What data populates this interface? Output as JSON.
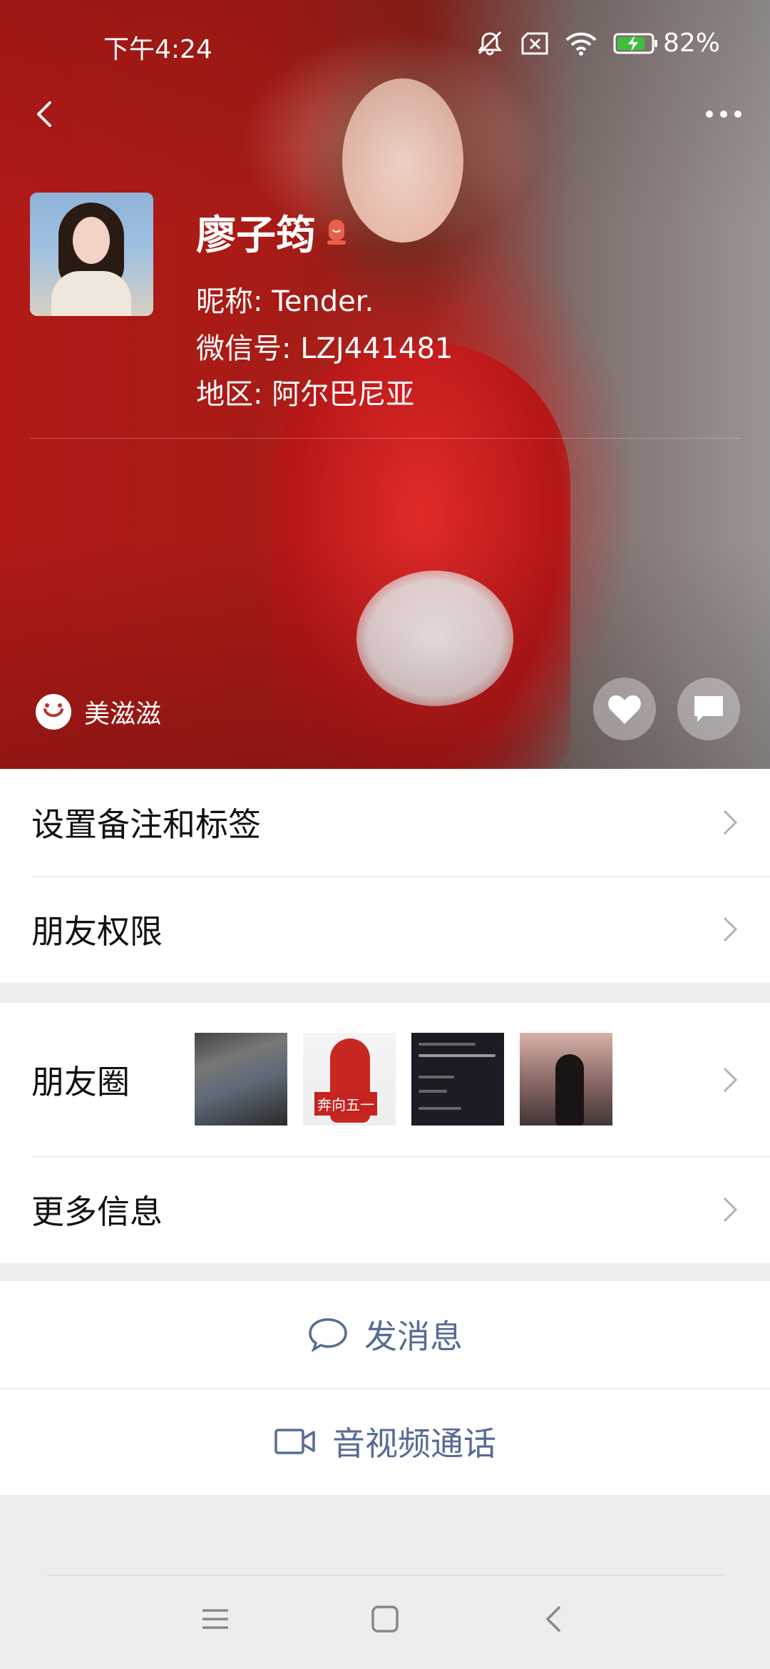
{
  "status_bar": {
    "time": "下午4:24",
    "battery": "82%",
    "icons": [
      "mute-bell-icon",
      "no-sim-icon",
      "wifi-icon",
      "battery-charging-icon"
    ]
  },
  "header": {
    "display_name": "廖子筠",
    "nickname": "昵称: Tender.",
    "wechat_id": "微信号: LZJ441481",
    "region": "地区: 阿尔巴尼亚",
    "status_text": "美滋滋"
  },
  "menu": {
    "remark_tags": "设置备注和标签",
    "friend_permissions": "朋友权限",
    "moments": "朋友圈",
    "moments_thumb2_tag": "奔向五一",
    "more_info": "更多信息"
  },
  "actions": {
    "send_message": "发消息",
    "video_call": "音视频通话"
  },
  "colors": {
    "link_blue": "#576b95",
    "background": "#ededed",
    "cover_red": "#b11a17"
  }
}
